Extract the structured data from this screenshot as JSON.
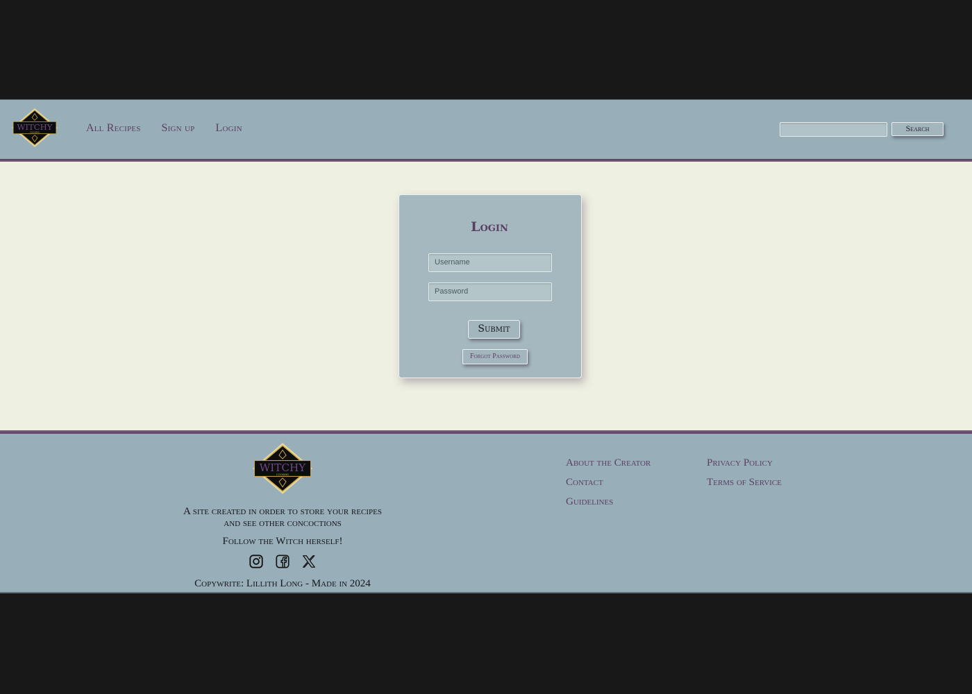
{
  "colors": {
    "outer_background": "#181818",
    "bar_background": "#98aeb8",
    "accent_purple": "#5a3f63",
    "main_background": "#eef0e2",
    "logo_gold": "#c9a84a"
  },
  "logo": {
    "word": "WITCHY",
    "sub": "COOKING",
    "icon": "witchy-cooking-logo"
  },
  "header": {
    "nav": [
      "All Recipes",
      "Sign up",
      "Login"
    ],
    "search_placeholder": "",
    "search_label": "Search"
  },
  "login": {
    "title": "Login",
    "username_placeholder": "Username",
    "password_placeholder": "Password",
    "submit_label": "Submit",
    "forgot_label": "Forgot Password"
  },
  "footer": {
    "tagline": "A site created in order to store your recipes and see other concoctions",
    "follow": "Follow the Witch herself!",
    "social": [
      "instagram-icon",
      "facebook-icon",
      "x-icon"
    ],
    "copyright": "Copywrite: Lillith Long - Made in 2024",
    "links_col1": [
      "About the Creator",
      "Contact",
      "Guidelines"
    ],
    "links_col2": [
      "Privacy Policy",
      "Terms of Service"
    ]
  }
}
